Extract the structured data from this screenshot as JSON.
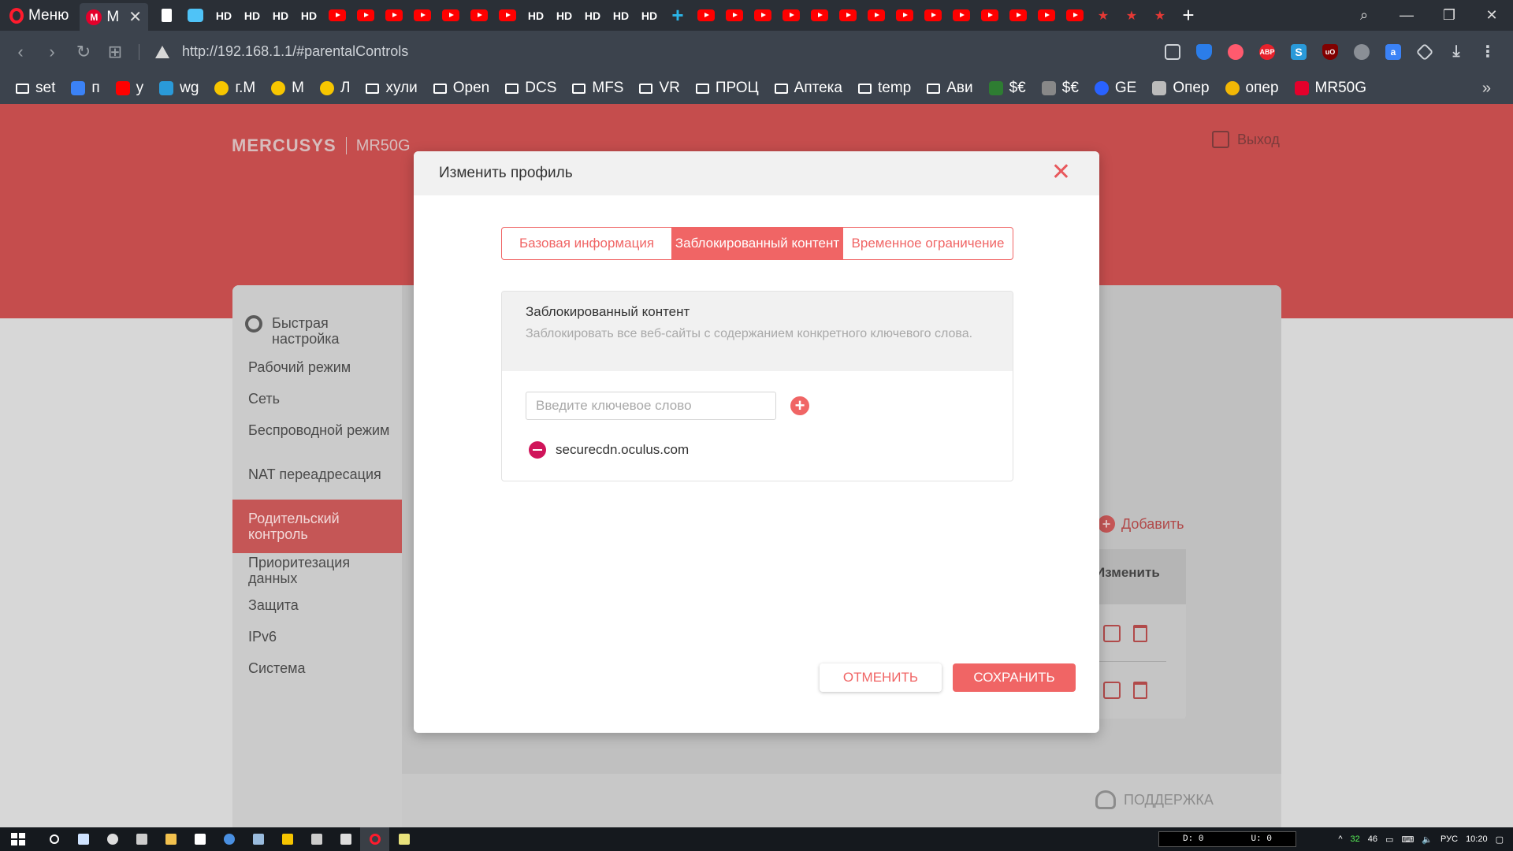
{
  "browser": {
    "menu_label": "Меню",
    "active_tab_title": "M",
    "hd_label": "HD",
    "url": "http://192.168.1.1/#parentalControls",
    "bookmarks": [
      {
        "label": "set",
        "icon": "folder-icon"
      },
      {
        "label": "п",
        "icon": "translate-icon"
      },
      {
        "label": "у",
        "icon": "youtube-icon"
      },
      {
        "label": "wg",
        "icon": "s-icon"
      },
      {
        "label": "г.М",
        "icon": "sun-icon"
      },
      {
        "label": "М",
        "icon": "sun-icon"
      },
      {
        "label": "Л",
        "icon": "sun-icon"
      },
      {
        "label": "хули",
        "icon": "folder-icon"
      },
      {
        "label": "Open",
        "icon": "folder-icon"
      },
      {
        "label": "DCS",
        "icon": "folder-icon"
      },
      {
        "label": "MFS",
        "icon": "folder-icon"
      },
      {
        "label": "VR",
        "icon": "folder-icon"
      },
      {
        "label": "ПРОЦ",
        "icon": "folder-icon"
      },
      {
        "label": "Аптека",
        "icon": "folder-icon"
      },
      {
        "label": "temp",
        "icon": "folder-icon"
      },
      {
        "label": "Ави",
        "icon": "folder-icon"
      },
      {
        "label": "$€",
        "icon": "e-icon"
      },
      {
        "label": "$€",
        "icon": "bg-icon"
      },
      {
        "label": "GE",
        "icon": "globe-icon"
      },
      {
        "label": "Опер",
        "icon": "phone-icon"
      },
      {
        "label": "опер",
        "icon": "coin-icon"
      },
      {
        "label": "MR50G",
        "icon": "mercusys-icon"
      }
    ],
    "extensions": [
      {
        "label": "",
        "color": "#3c434d",
        "icon": "camera-icon"
      },
      {
        "label": "",
        "color": "#2b7de9",
        "icon": "shield-icon"
      },
      {
        "label": "",
        "color": "#ff5a6e",
        "icon": "heart-icon"
      },
      {
        "label": "ABP",
        "color": "#e8212b",
        "icon": "adblock-icon"
      },
      {
        "label": "S",
        "color": "#2a9ad9",
        "icon": "s-ext-icon"
      },
      {
        "label": "uO",
        "color": "#800000",
        "icon": "ublock-icon"
      },
      {
        "label": "",
        "color": "#8a8f96",
        "icon": "globe-icon"
      },
      {
        "label": "a",
        "color": "#3b82f6",
        "icon": "translate-icon"
      },
      {
        "label": "",
        "color": "#3c434d",
        "icon": "cube-icon"
      },
      {
        "label": "",
        "color": "#3c434d",
        "icon": "download-icon"
      },
      {
        "label": "",
        "color": "#3c434d",
        "icon": "more-icon"
      }
    ]
  },
  "router": {
    "brand": "MERCUSYS",
    "model": "MR50G",
    "logout_label": "Выход",
    "sidebar": [
      {
        "label": "Быстрая настройка",
        "active": false
      },
      {
        "label": "Рабочий режим",
        "active": false
      },
      {
        "label": "Сеть",
        "active": false
      },
      {
        "label": "Беспроводной режим",
        "active": false
      },
      {
        "label": "NAT переадресация",
        "active": false
      },
      {
        "label": "Родительский контроль",
        "active": true
      },
      {
        "label": "Приоритезация данных",
        "active": false
      },
      {
        "label": "Защита",
        "active": false
      },
      {
        "label": "IPv6",
        "active": false
      },
      {
        "label": "Система",
        "active": false
      }
    ],
    "bg_add_label": "Добавить",
    "bg_table_header": "Изменить",
    "support_label": "ПОДДЕРЖКА"
  },
  "modal": {
    "title": "Изменить профиль",
    "tabs": [
      {
        "label": "Базовая информация",
        "active": false
      },
      {
        "label": "Заблокированный контент",
        "active": true
      },
      {
        "label": "Временное ограничение",
        "active": false
      }
    ],
    "section_title": "Заблокированный контент",
    "section_desc": "Заблокировать все веб-сайты с содержанием конкретного ключевого слова.",
    "keyword_placeholder": "Введите ключевое слово",
    "keyword_value": "",
    "keywords": [
      "securecdn.oculus.com"
    ],
    "cancel_label": "ОТМЕНИТЬ",
    "save_label": "СОХРАНИТЬ"
  },
  "taskbar": {
    "net_down": "D: 0",
    "net_up": "U: 0",
    "tray_num1": "32",
    "tray_num2": "46",
    "language": "РУС",
    "time": "10:20"
  },
  "colors": {
    "accent": "#f06565",
    "header_band": "#c54d4d",
    "active_sidebar": "#c55656"
  }
}
